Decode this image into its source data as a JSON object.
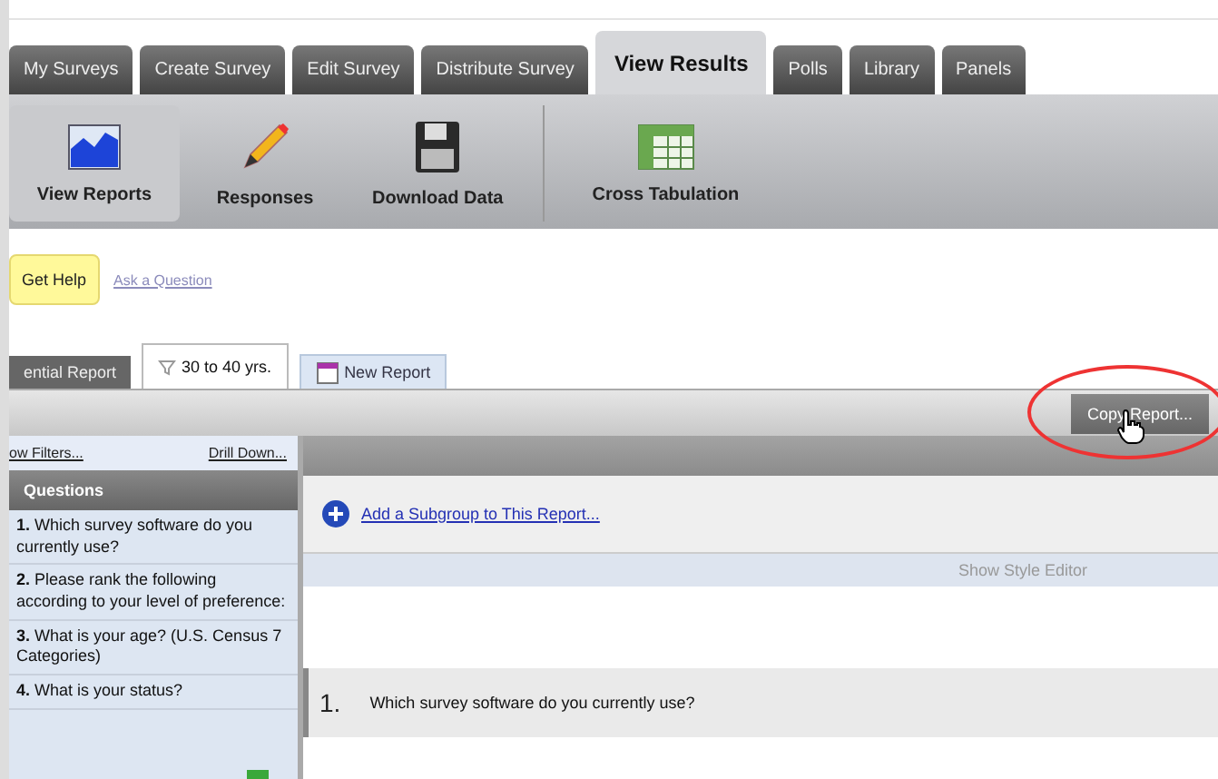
{
  "main_tabs": [
    {
      "label": "My Surveys",
      "selected": false
    },
    {
      "label": "Create Survey",
      "selected": false
    },
    {
      "label": "Edit Survey",
      "selected": false
    },
    {
      "label": "Distribute Survey",
      "selected": false
    },
    {
      "label": "View Results",
      "selected": true
    },
    {
      "label": "Polls",
      "selected": false
    },
    {
      "label": "Library",
      "selected": false
    },
    {
      "label": "Panels",
      "selected": false
    }
  ],
  "toolbar": [
    {
      "label": "View Reports",
      "kind": "chart",
      "selected": true
    },
    {
      "label": "Responses",
      "kind": "pencil",
      "selected": false
    },
    {
      "label": "Download Data",
      "kind": "disk",
      "selected": false
    },
    {
      "label": "Cross Tabulation",
      "kind": "table",
      "selected": false
    }
  ],
  "help": {
    "button": "Get Help",
    "link": "Ask a Question"
  },
  "report_tabs": [
    {
      "label": "ential Report",
      "kind": "plain",
      "selected": false
    },
    {
      "label": "30 to 40 yrs.",
      "kind": "filter",
      "selected": true
    },
    {
      "label": "New Report",
      "kind": "new",
      "selected": false
    }
  ],
  "copy_button": "Copy Report...",
  "filters": {
    "left": "ow Filters...",
    "right": "Drill Down..."
  },
  "questions": {
    "title": "Questions",
    "items": [
      "**1.** Which survey software do you currently use?",
      "**2.** Please rank the following according to your level of preference:",
      "**3.** What is your age? (U.S. Census 7 Categories)",
      "**4.** What is your status?"
    ]
  },
  "subgroup_link": "Add a Subgroup to This Report...",
  "style_editor": "Show Style Editor",
  "question_row": {
    "number": "1.",
    "text": "Which survey software do you currently use?"
  }
}
